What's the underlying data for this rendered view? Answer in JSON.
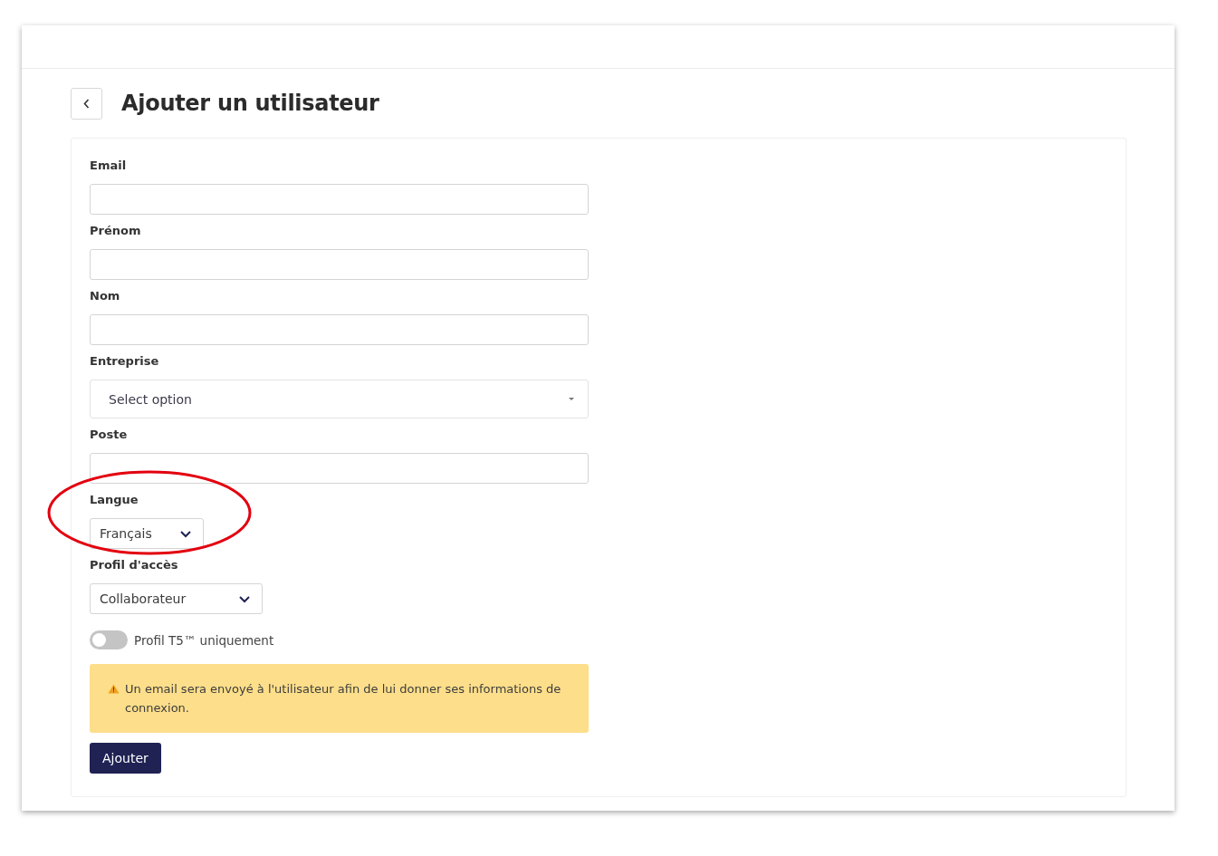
{
  "page": {
    "title": "Ajouter un utilisateur"
  },
  "fields": [
    {
      "kind": "text",
      "label": "Email",
      "highlighted": false
    },
    {
      "kind": "text",
      "label": "Prénom",
      "highlighted": false
    },
    {
      "kind": "text",
      "label": "Nom",
      "highlighted": false
    },
    {
      "kind": "select",
      "label": "Entreprise",
      "placeholder": "Select option",
      "highlighted": false
    },
    {
      "kind": "text",
      "label": "Poste",
      "highlighted": false
    },
    {
      "kind": "dropdown",
      "label": "Langue",
      "value": "Français",
      "highlighted": true
    },
    {
      "kind": "dropdown",
      "label": "Profil d'accès",
      "value": "Collaborateur",
      "highlighted": false
    }
  ],
  "toggle": {
    "label": "Profil T5™ uniquement",
    "on": false
  },
  "notice": {
    "text": "Un email sera envoyé à l'utilisateur afin de lui donner ses informations de connexion."
  },
  "submit": "Ajouter"
}
